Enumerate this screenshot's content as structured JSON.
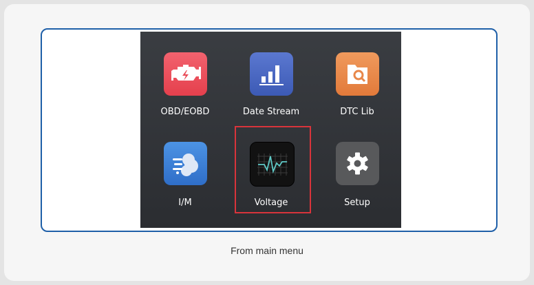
{
  "menu": {
    "items": [
      {
        "label": "OBD/EOBD",
        "icon": "engine-check-icon",
        "color": "#e94a56"
      },
      {
        "label": "Date Stream",
        "icon": "bar-chart-icon",
        "color": "#4764c4"
      },
      {
        "label": "DTC Lib",
        "icon": "folder-search-icon",
        "color": "#e8874a"
      },
      {
        "label": "I/M",
        "icon": "emissions-cloud-icon",
        "color": "#3a7fd8"
      },
      {
        "label": "Voltage",
        "icon": "waveform-icon",
        "color": "#121212",
        "highlighted": true
      },
      {
        "label": "Setup",
        "icon": "gear-icon",
        "color": "#58595b"
      }
    ]
  },
  "caption": "From main menu",
  "colors": {
    "frame_border": "#1e5fa8",
    "highlight_border": "#d9343b",
    "screen_bg": "#33363b"
  }
}
